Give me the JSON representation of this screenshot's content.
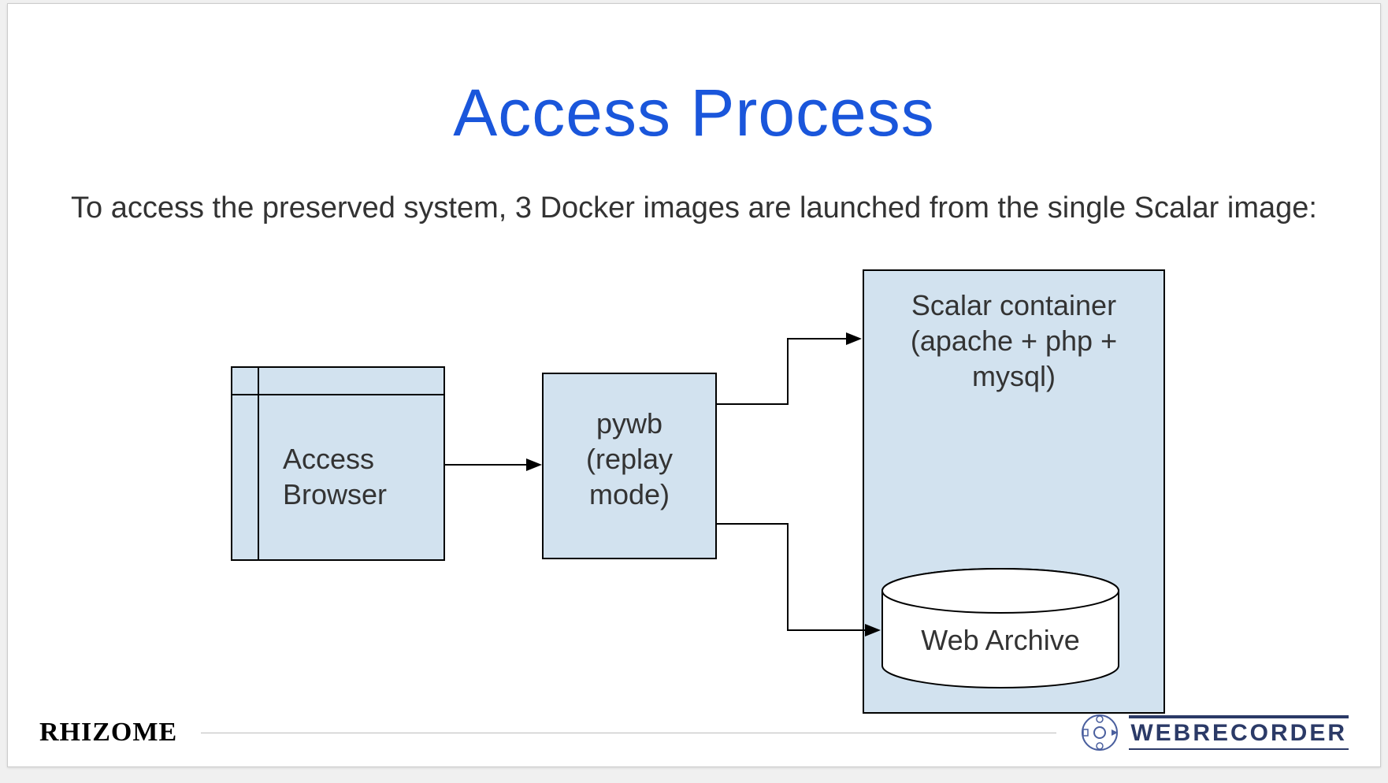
{
  "title": "Access Process",
  "body_text": "To access the preserved system, 3 Docker images are launched from the single Scalar image:",
  "diagram": {
    "browser": {
      "line1": "Access",
      "line2": "Browser"
    },
    "pywb": {
      "line1": "pywb",
      "line2": "(replay",
      "line3": "mode)"
    },
    "scalar": {
      "line1": "Scalar container",
      "line2": "(apache + php +",
      "line3": "mysql)"
    },
    "archive": "Web Archive"
  },
  "footer": {
    "left": "RHIZOME",
    "right": "WEBRECORDER"
  }
}
